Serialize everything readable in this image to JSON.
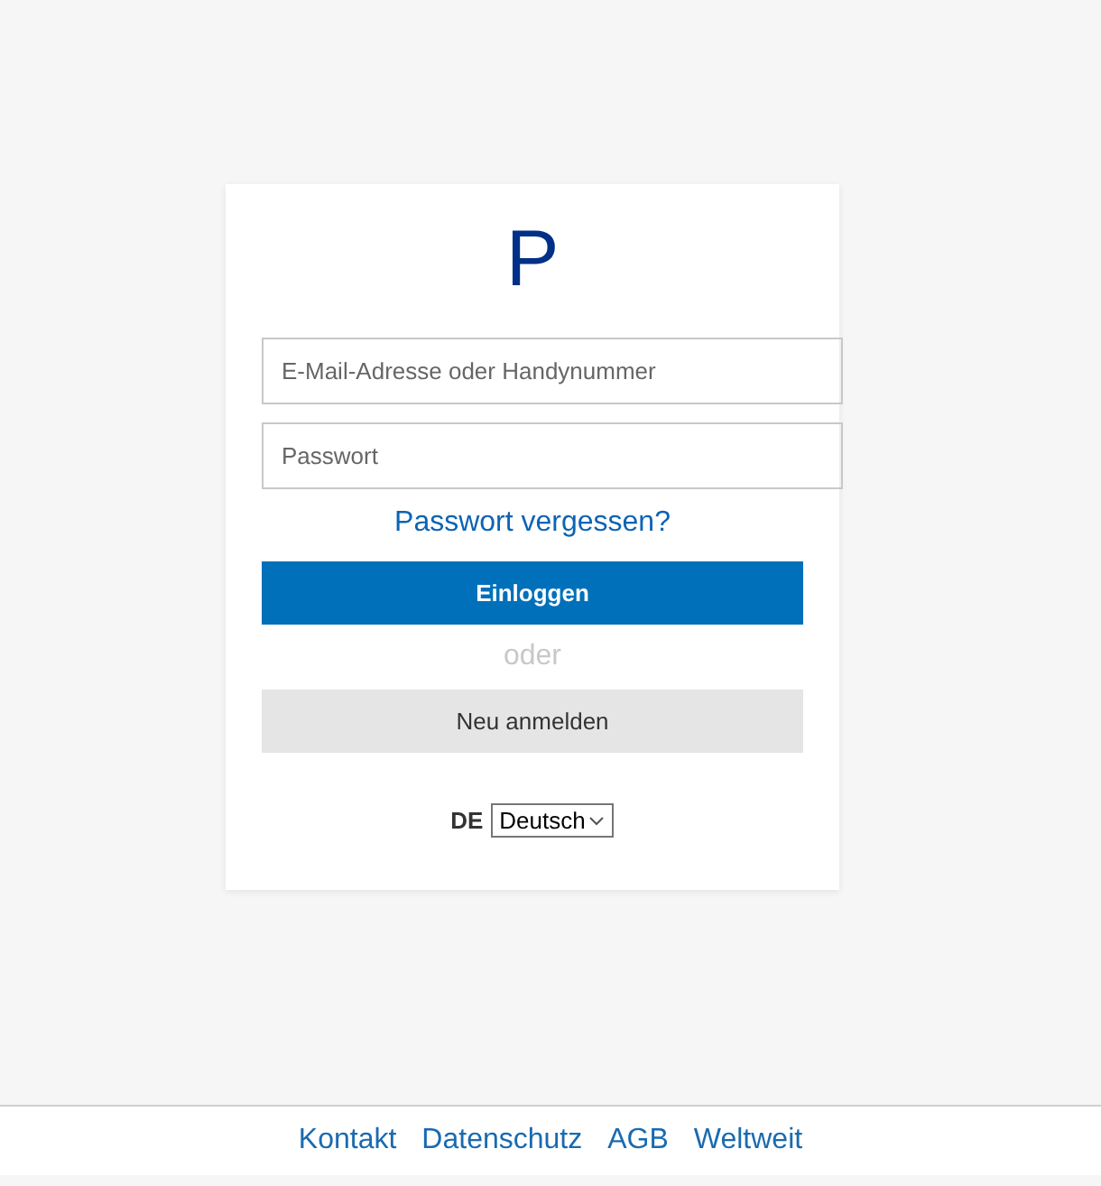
{
  "logo": "P",
  "email_field": {
    "placeholder": "E-Mail-Adresse oder Handynummer"
  },
  "password_field": {
    "placeholder": "Passwort"
  },
  "forgot_link": "Passwort vergessen?",
  "login_button": "Einloggen",
  "separator": "oder",
  "signup_button": "Neu anmelden",
  "language": {
    "code": "DE",
    "selected": "Deutsch"
  },
  "footer_links": [
    "Kontakt",
    "Datenschutz",
    "AGB",
    "Weltweit"
  ]
}
